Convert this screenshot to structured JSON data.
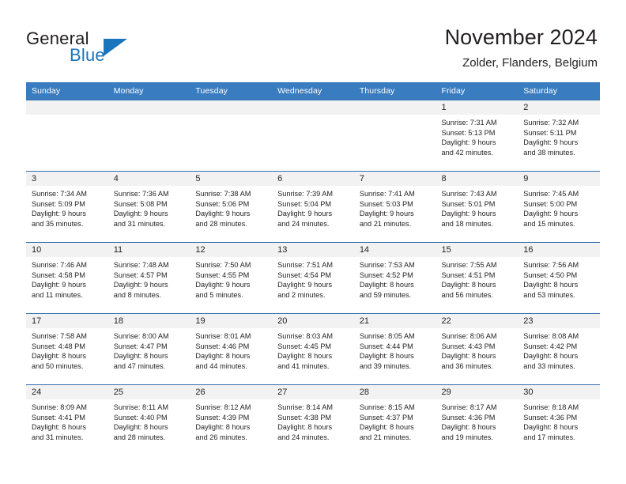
{
  "brand": {
    "name_part1": "General",
    "name_part2": "Blue",
    "accent_color": "#1b75bc"
  },
  "header": {
    "title": "November 2024",
    "location": "Zolder, Flanders, Belgium"
  },
  "theme": {
    "header_row_bg": "#3a7cc0",
    "daynum_bg": "#f2f2f2",
    "text_color": "#231f20"
  },
  "calendar": {
    "weekday_headers": [
      "Sunday",
      "Monday",
      "Tuesday",
      "Wednesday",
      "Thursday",
      "Friday",
      "Saturday"
    ],
    "weeks": [
      [
        {
          "day": "",
          "empty": true
        },
        {
          "day": "",
          "empty": true
        },
        {
          "day": "",
          "empty": true
        },
        {
          "day": "",
          "empty": true
        },
        {
          "day": "",
          "empty": true
        },
        {
          "day": "1",
          "sunrise": "Sunrise: 7:31 AM",
          "sunset": "Sunset: 5:13 PM",
          "daylight1": "Daylight: 9 hours",
          "daylight2": "and 42 minutes."
        },
        {
          "day": "2",
          "sunrise": "Sunrise: 7:32 AM",
          "sunset": "Sunset: 5:11 PM",
          "daylight1": "Daylight: 9 hours",
          "daylight2": "and 38 minutes."
        }
      ],
      [
        {
          "day": "3",
          "sunrise": "Sunrise: 7:34 AM",
          "sunset": "Sunset: 5:09 PM",
          "daylight1": "Daylight: 9 hours",
          "daylight2": "and 35 minutes."
        },
        {
          "day": "4",
          "sunrise": "Sunrise: 7:36 AM",
          "sunset": "Sunset: 5:08 PM",
          "daylight1": "Daylight: 9 hours",
          "daylight2": "and 31 minutes."
        },
        {
          "day": "5",
          "sunrise": "Sunrise: 7:38 AM",
          "sunset": "Sunset: 5:06 PM",
          "daylight1": "Daylight: 9 hours",
          "daylight2": "and 28 minutes."
        },
        {
          "day": "6",
          "sunrise": "Sunrise: 7:39 AM",
          "sunset": "Sunset: 5:04 PM",
          "daylight1": "Daylight: 9 hours",
          "daylight2": "and 24 minutes."
        },
        {
          "day": "7",
          "sunrise": "Sunrise: 7:41 AM",
          "sunset": "Sunset: 5:03 PM",
          "daylight1": "Daylight: 9 hours",
          "daylight2": "and 21 minutes."
        },
        {
          "day": "8",
          "sunrise": "Sunrise: 7:43 AM",
          "sunset": "Sunset: 5:01 PM",
          "daylight1": "Daylight: 9 hours",
          "daylight2": "and 18 minutes."
        },
        {
          "day": "9",
          "sunrise": "Sunrise: 7:45 AM",
          "sunset": "Sunset: 5:00 PM",
          "daylight1": "Daylight: 9 hours",
          "daylight2": "and 15 minutes."
        }
      ],
      [
        {
          "day": "10",
          "sunrise": "Sunrise: 7:46 AM",
          "sunset": "Sunset: 4:58 PM",
          "daylight1": "Daylight: 9 hours",
          "daylight2": "and 11 minutes."
        },
        {
          "day": "11",
          "sunrise": "Sunrise: 7:48 AM",
          "sunset": "Sunset: 4:57 PM",
          "daylight1": "Daylight: 9 hours",
          "daylight2": "and 8 minutes."
        },
        {
          "day": "12",
          "sunrise": "Sunrise: 7:50 AM",
          "sunset": "Sunset: 4:55 PM",
          "daylight1": "Daylight: 9 hours",
          "daylight2": "and 5 minutes."
        },
        {
          "day": "13",
          "sunrise": "Sunrise: 7:51 AM",
          "sunset": "Sunset: 4:54 PM",
          "daylight1": "Daylight: 9 hours",
          "daylight2": "and 2 minutes."
        },
        {
          "day": "14",
          "sunrise": "Sunrise: 7:53 AM",
          "sunset": "Sunset: 4:52 PM",
          "daylight1": "Daylight: 8 hours",
          "daylight2": "and 59 minutes."
        },
        {
          "day": "15",
          "sunrise": "Sunrise: 7:55 AM",
          "sunset": "Sunset: 4:51 PM",
          "daylight1": "Daylight: 8 hours",
          "daylight2": "and 56 minutes."
        },
        {
          "day": "16",
          "sunrise": "Sunrise: 7:56 AM",
          "sunset": "Sunset: 4:50 PM",
          "daylight1": "Daylight: 8 hours",
          "daylight2": "and 53 minutes."
        }
      ],
      [
        {
          "day": "17",
          "sunrise": "Sunrise: 7:58 AM",
          "sunset": "Sunset: 4:48 PM",
          "daylight1": "Daylight: 8 hours",
          "daylight2": "and 50 minutes."
        },
        {
          "day": "18",
          "sunrise": "Sunrise: 8:00 AM",
          "sunset": "Sunset: 4:47 PM",
          "daylight1": "Daylight: 8 hours",
          "daylight2": "and 47 minutes."
        },
        {
          "day": "19",
          "sunrise": "Sunrise: 8:01 AM",
          "sunset": "Sunset: 4:46 PM",
          "daylight1": "Daylight: 8 hours",
          "daylight2": "and 44 minutes."
        },
        {
          "day": "20",
          "sunrise": "Sunrise: 8:03 AM",
          "sunset": "Sunset: 4:45 PM",
          "daylight1": "Daylight: 8 hours",
          "daylight2": "and 41 minutes."
        },
        {
          "day": "21",
          "sunrise": "Sunrise: 8:05 AM",
          "sunset": "Sunset: 4:44 PM",
          "daylight1": "Daylight: 8 hours",
          "daylight2": "and 39 minutes."
        },
        {
          "day": "22",
          "sunrise": "Sunrise: 8:06 AM",
          "sunset": "Sunset: 4:43 PM",
          "daylight1": "Daylight: 8 hours",
          "daylight2": "and 36 minutes."
        },
        {
          "day": "23",
          "sunrise": "Sunrise: 8:08 AM",
          "sunset": "Sunset: 4:42 PM",
          "daylight1": "Daylight: 8 hours",
          "daylight2": "and 33 minutes."
        }
      ],
      [
        {
          "day": "24",
          "sunrise": "Sunrise: 8:09 AM",
          "sunset": "Sunset: 4:41 PM",
          "daylight1": "Daylight: 8 hours",
          "daylight2": "and 31 minutes."
        },
        {
          "day": "25",
          "sunrise": "Sunrise: 8:11 AM",
          "sunset": "Sunset: 4:40 PM",
          "daylight1": "Daylight: 8 hours",
          "daylight2": "and 28 minutes."
        },
        {
          "day": "26",
          "sunrise": "Sunrise: 8:12 AM",
          "sunset": "Sunset: 4:39 PM",
          "daylight1": "Daylight: 8 hours",
          "daylight2": "and 26 minutes."
        },
        {
          "day": "27",
          "sunrise": "Sunrise: 8:14 AM",
          "sunset": "Sunset: 4:38 PM",
          "daylight1": "Daylight: 8 hours",
          "daylight2": "and 24 minutes."
        },
        {
          "day": "28",
          "sunrise": "Sunrise: 8:15 AM",
          "sunset": "Sunset: 4:37 PM",
          "daylight1": "Daylight: 8 hours",
          "daylight2": "and 21 minutes."
        },
        {
          "day": "29",
          "sunrise": "Sunrise: 8:17 AM",
          "sunset": "Sunset: 4:36 PM",
          "daylight1": "Daylight: 8 hours",
          "daylight2": "and 19 minutes."
        },
        {
          "day": "30",
          "sunrise": "Sunrise: 8:18 AM",
          "sunset": "Sunset: 4:36 PM",
          "daylight1": "Daylight: 8 hours",
          "daylight2": "and 17 minutes."
        }
      ]
    ]
  }
}
